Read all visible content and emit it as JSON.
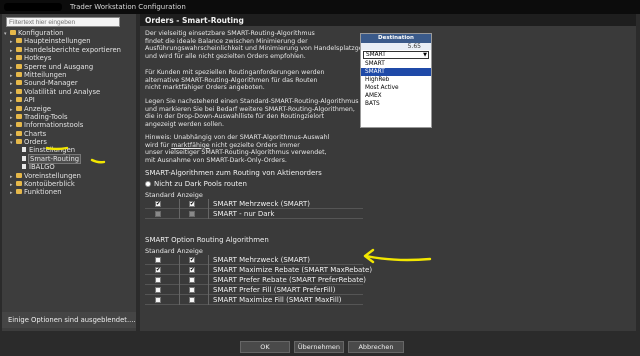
{
  "window": {
    "title": "Trader Workstation Configuration"
  },
  "left": {
    "filter_placeholder": "Filtertext hier eingeben",
    "tree": [
      {
        "label": "Konfiguration",
        "icon": "folder-icon",
        "indent": 0,
        "arrow": "▾"
      },
      {
        "label": "Haupteinstellungen",
        "icon": "folder-icon",
        "indent": 1,
        "arrow": "▸"
      },
      {
        "label": "Handelsberichte exportieren",
        "icon": "folder-icon",
        "indent": 1,
        "arrow": "▸"
      },
      {
        "label": "Hotkeys",
        "icon": "folder-icon",
        "indent": 1,
        "arrow": "▸"
      },
      {
        "label": "Sperre und Ausgang",
        "icon": "folder-icon",
        "indent": 1,
        "arrow": "▸"
      },
      {
        "label": "Mitteilungen",
        "icon": "folder-icon",
        "indent": 1,
        "arrow": "▸"
      },
      {
        "label": "Sound-Manager",
        "icon": "folder-icon",
        "indent": 1,
        "arrow": "▸"
      },
      {
        "label": "Volatilität und Analyse",
        "icon": "folder-icon",
        "indent": 1,
        "arrow": "▸"
      },
      {
        "label": "API",
        "icon": "folder-icon",
        "indent": 1,
        "arrow": "▸"
      },
      {
        "label": "Anzeige",
        "icon": "folder-icon",
        "indent": 1,
        "arrow": "▸"
      },
      {
        "label": "Trading-Tools",
        "icon": "folder-icon",
        "indent": 1,
        "arrow": "▸"
      },
      {
        "label": "Informationstools",
        "icon": "folder-icon",
        "indent": 1,
        "arrow": "▸"
      },
      {
        "label": "Charts",
        "icon": "folder-icon",
        "indent": 1,
        "arrow": "▸"
      },
      {
        "label": "Orders",
        "icon": "folder-icon",
        "indent": 1,
        "arrow": "▾"
      },
      {
        "label": "Einstellungen",
        "icon": "doc-icon",
        "indent": 2,
        "arrow": ""
      },
      {
        "label": "Smart-Routing",
        "icon": "doc-icon",
        "indent": 2,
        "arrow": "",
        "selected": true
      },
      {
        "label": "IBALGO",
        "icon": "doc-icon",
        "indent": 2,
        "arrow": ""
      },
      {
        "label": "Voreinstellungen",
        "icon": "folder-icon",
        "indent": 1,
        "arrow": "▸"
      },
      {
        "label": "Kontoüberblick",
        "icon": "folder-icon",
        "indent": 1,
        "arrow": "▸"
      },
      {
        "label": "Funktionen",
        "icon": "folder-icon",
        "indent": 1,
        "arrow": "▸"
      }
    ],
    "few_options_label": "Einige Optionen sind ausgeblendet...."
  },
  "main": {
    "title": "Orders - Smart-Routing",
    "intro_1": "Der vielseitig einsetzbare SMART-Routing-Algorithmus\nfindet die ideale Balance zwischen Minimierung der\nAusführungswahrscheinlichkeit und Minimierung von Handelsplatzgebühren,\nund wird für alle nicht gezielten Orders empfohlen.",
    "intro_2": "Für Kunden mit speziellen Routinganforderungen werden\nalternative SMART-Routing-Algorithmen für das Routen\nnicht marktfähiger Orders angeboten.",
    "intro_3": "Legen Sie nachstehend einen Standard-SMART-Routing-Algorithmus fest\nund markieren Sie bei Bedarf weitere SMART-Routing-Algorithmen,\ndie in der Drop-Down-Auswahlliste für den Routingzielort\nangezeigt werden sollen.",
    "hint_prefix": "Hinweis: Unabhängig von der SMART-Algorithmus-Auswahl\nwird für ",
    "hint_link": "marktfähige",
    "hint_suffix": " nicht gezielte Orders immer\nunser vielseitiger SMART-Routing-Algorithmus verwendet,\nmit Ausnahme von SMART-Dark-Only-Orders.",
    "destination": {
      "header": "Destination",
      "price": "5.65",
      "selected": "SMART",
      "options": [
        "SMART",
        "SMART",
        "HighReb",
        "Most Active",
        "AMEX",
        "BATS"
      ]
    },
    "stock_section_title": "SMART-Algorithmen zum Routing von Aktienorders",
    "dark_pools_label": "Nicht zu Dark Pools routen",
    "col_standard": "Standard",
    "col_anzeige": "Anzeige",
    "stock_rows": [
      {
        "name": "SMART Mehrzweck (SMART)",
        "standard": true,
        "anzeige": true,
        "disabled": false
      },
      {
        "name": "SMART - nur Dark",
        "standard": false,
        "anzeige": false,
        "disabled": true
      }
    ],
    "option_section_title": "SMART Option Routing Algorithmen",
    "option_rows": [
      {
        "name": "SMART Mehrzweck (SMART)",
        "standard": false,
        "anzeige": true
      },
      {
        "name": "SMART Maximize Rebate (SMART MaxRebate)",
        "standard": true,
        "anzeige": true
      },
      {
        "name": "SMART Prefer Rebate (SMART PreferRebate)",
        "standard": false,
        "anzeige": false
      },
      {
        "name": "SMART Prefer Fill (SMART PreferFill)",
        "standard": false,
        "anzeige": false
      },
      {
        "name": "SMART Maximize Fill (SMART MaxFill)",
        "standard": false,
        "anzeige": false
      }
    ]
  },
  "buttons": {
    "ok": "OK",
    "apply": "Übernehmen",
    "cancel": "Abbrechen"
  },
  "colors": {
    "annotation": "#f2e600",
    "selection": "#1f4aa8"
  }
}
